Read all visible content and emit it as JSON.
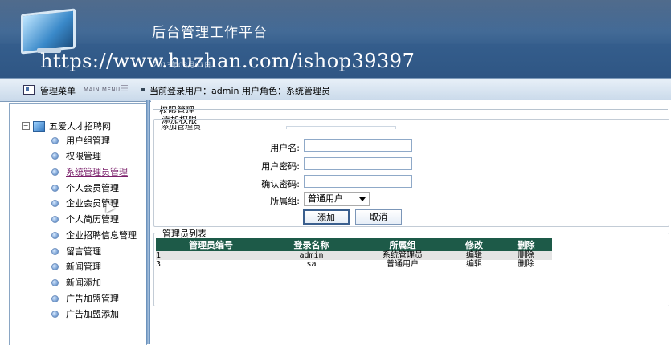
{
  "header": {
    "title": "后台管理工作平台",
    "watermark": "https://www.huzhan.com/ishop39397",
    "date_text": "2013年03月01日"
  },
  "navbar": {
    "menu_label": "管理菜单",
    "menu_en": "MAIN MENU",
    "toggle": "☰",
    "login_info": "当前登录用户：admin 用户角色：系统管理员"
  },
  "sidebar": {
    "root": "五爱人才招聘网",
    "items": [
      {
        "label": "用户组管理"
      },
      {
        "label": "权限管理"
      },
      {
        "label": "系统管理员管理"
      },
      {
        "label": "个人会员管理"
      },
      {
        "label": "企业会员管理"
      },
      {
        "label": "个人简历管理"
      },
      {
        "label": "企业招聘信息管理"
      },
      {
        "label": "留言管理"
      },
      {
        "label": "新闻管理"
      },
      {
        "label": "新闻添加"
      },
      {
        "label": "广告加盟管理"
      },
      {
        "label": "广告加盟添加"
      }
    ]
  },
  "main": {
    "section_title": "权限管理",
    "add_title": "添加权限",
    "add_admin_title": "添加管理员",
    "form": {
      "username_label": "用户名:",
      "password_label": "用户密码:",
      "confirm_label": "确认密码:",
      "group_label": "所属组:",
      "group_selected": "普通用户",
      "username_value": "",
      "password_value": "",
      "confirm_value": "",
      "submit": "添加",
      "cancel": "取消"
    },
    "list": {
      "title": "管理员列表",
      "headers": [
        "管理员编号",
        "登录名称",
        "所属组",
        "修改",
        "删除"
      ],
      "rows": [
        [
          "1",
          "admin",
          "系统管理员",
          "编辑",
          "删除"
        ],
        [
          "3",
          "sa",
          "普通用户",
          "编辑",
          "删除"
        ]
      ]
    }
  }
}
